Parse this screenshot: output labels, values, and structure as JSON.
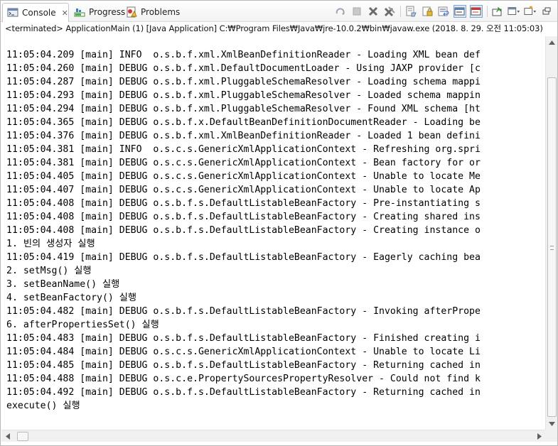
{
  "tabs": [
    {
      "label": "Console",
      "active": true,
      "icon": "console-icon"
    },
    {
      "label": "Progress",
      "active": false,
      "icon": "progress-icon"
    },
    {
      "label": "Problems",
      "active": false,
      "icon": "problems-icon"
    }
  ],
  "toolbar": {
    "icons": [
      "remove-launch-icon",
      "terminate-icon",
      "remove-all-terminated-icon",
      "remove-terminated-icon",
      "clear-console-icon",
      "scroll-lock-icon",
      "word-wrap-icon",
      "show-on-stdout-icon",
      "show-on-stderr-icon",
      "pin-console-icon",
      "display-console-icon",
      "open-console-icon",
      "minimize-icon"
    ]
  },
  "path_line": "<terminated> ApplicationMain (1) [Java Application] C:₩Program Files₩Java₩jre-10.0.2₩bin₩javaw.exe (2018. 8. 29. 오전 11:05:03)",
  "console_lines": [
    "11:05:04.209 [main] INFO  o.s.b.f.xml.XmlBeanDefinitionReader - Loading XML bean def",
    "11:05:04.260 [main] DEBUG o.s.b.f.xml.DefaultDocumentLoader - Using JAXP provider [c",
    "11:05:04.287 [main] DEBUG o.s.b.f.xml.PluggableSchemaResolver - Loading schema mappi",
    "11:05:04.293 [main] DEBUG o.s.b.f.xml.PluggableSchemaResolver - Loaded schema mappin",
    "11:05:04.294 [main] DEBUG o.s.b.f.xml.PluggableSchemaResolver - Found XML schema [ht",
    "11:05:04.365 [main] DEBUG o.s.b.f.x.DefaultBeanDefinitionDocumentReader - Loading be",
    "11:05:04.376 [main] DEBUG o.s.b.f.xml.XmlBeanDefinitionReader - Loaded 1 bean defini",
    "11:05:04.381 [main] INFO  o.s.c.s.GenericXmlApplicationContext - Refreshing org.spri",
    "11:05:04.381 [main] DEBUG o.s.c.s.GenericXmlApplicationContext - Bean factory for or",
    "11:05:04.405 [main] DEBUG o.s.c.s.GenericXmlApplicationContext - Unable to locate Me",
    "11:05:04.407 [main] DEBUG o.s.c.s.GenericXmlApplicationContext - Unable to locate Ap",
    "11:05:04.408 [main] DEBUG o.s.b.f.s.DefaultListableBeanFactory - Pre-instantiating s",
    "11:05:04.408 [main] DEBUG o.s.b.f.s.DefaultListableBeanFactory - Creating shared ins",
    "11:05:04.408 [main] DEBUG o.s.b.f.s.DefaultListableBeanFactory - Creating instance o",
    "1. 빈의 생성자 실행",
    "11:05:04.419 [main] DEBUG o.s.b.f.s.DefaultListableBeanFactory - Eagerly caching bea",
    "2. setMsg() 실행",
    "3. setBeanName() 실행",
    "4. setBeanFactory() 실행",
    "11:05:04.482 [main] DEBUG o.s.b.f.s.DefaultListableBeanFactory - Invoking afterPrope",
    "6. afterPropertiesSet() 실행",
    "11:05:04.483 [main] DEBUG o.s.b.f.s.DefaultListableBeanFactory - Finished creating i",
    "11:05:04.484 [main] DEBUG o.s.c.s.GenericXmlApplicationContext - Unable to locate Li",
    "11:05:04.485 [main] DEBUG o.s.b.f.s.DefaultListableBeanFactory - Returning cached in",
    "11:05:04.488 [main] DEBUG o.s.c.e.PropertySourcesPropertyResolver - Could not find k",
    "11:05:04.492 [main] DEBUG o.s.b.f.s.DefaultListableBeanFactory - Returning cached in",
    "execute() 실행"
  ],
  "colors": {
    "console_text": "#000000",
    "selected_toggle": "#dde8f5"
  }
}
